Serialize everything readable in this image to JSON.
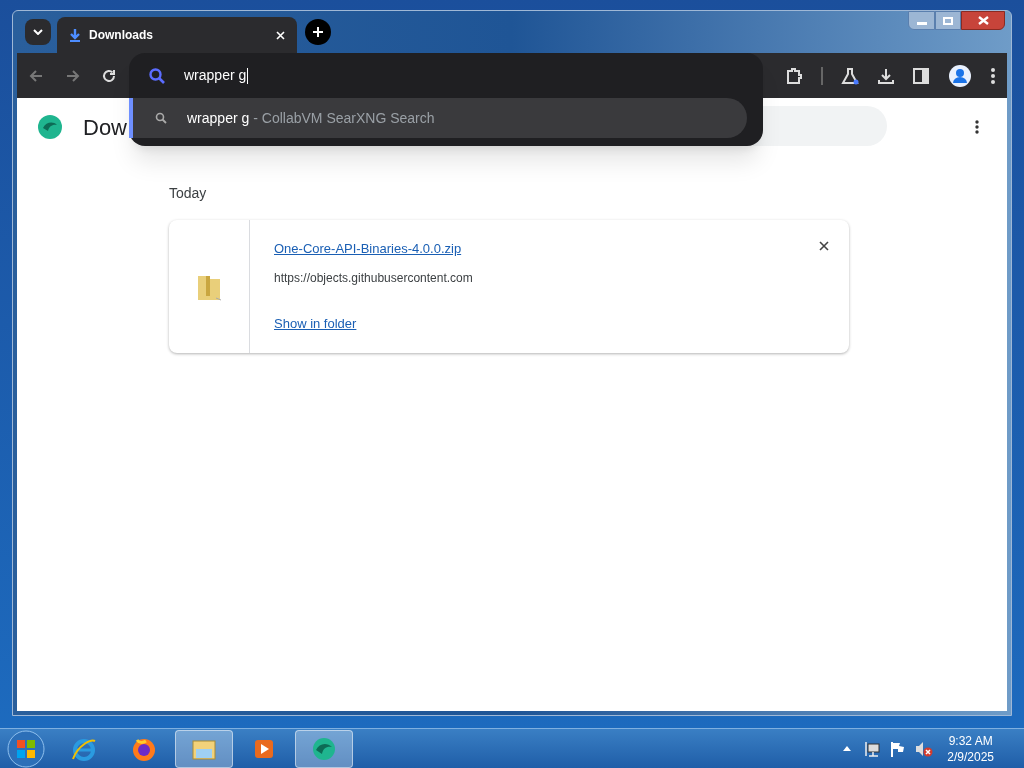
{
  "browser": {
    "tab": {
      "title": "Downloads",
      "selected": true
    },
    "omnibox": {
      "value": "wrapper g",
      "suggestions": [
        {
          "query": "wrapper g",
          "source": "- CollabVM SearXNG Search",
          "selected": true
        }
      ]
    },
    "page": {
      "title": "Dow",
      "section": "Today",
      "downloads": [
        {
          "file_name": "One-Core-API-Binaries-4.0.0.zip",
          "url": "https://objects.githubusercontent.com",
          "action": "Show in folder"
        }
      ]
    }
  },
  "taskbar": {
    "items": [
      {
        "kind": "ie",
        "running": false
      },
      {
        "kind": "firefox",
        "running": false
      },
      {
        "kind": "explorer",
        "running": true
      },
      {
        "kind": "media",
        "running": false
      },
      {
        "kind": "browser",
        "running": true
      }
    ],
    "clock": {
      "time": "9:32 AM",
      "date": "2/9/2025"
    }
  }
}
